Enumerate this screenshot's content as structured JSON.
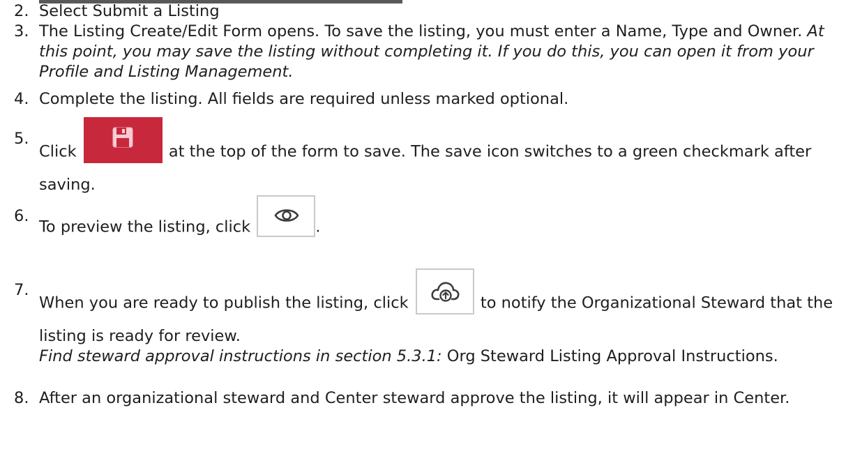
{
  "steps": [
    {
      "num": "2.",
      "text": "Select Submit a Listing"
    },
    {
      "num": "3.",
      "text": "The Listing Create/Edit Form opens. To save the listing, you must enter a Name, Type and Owner. ",
      "italic": "At this point, you may save the listing without completing it. If you do this, you can open it from your Profile and Listing Management."
    },
    {
      "num": "4.",
      "text": "Complete the listing. All fields are required unless marked optional."
    },
    {
      "num": "5.",
      "before": "Click ",
      "after": " at the top of the form to save. The save icon switches to a green checkmark after saving."
    },
    {
      "num": "6.",
      "before": "To preview the listing, click ",
      "after": "."
    },
    {
      "num": "7.",
      "before": "When you are ready to publish the listing, click ",
      "after": " to notify the Organizational Steward that the listing is ready for review.",
      "italic": "Find steward approval instructions in section 5.3.1:",
      "tail": " Org Steward Listing Approval Instructions."
    },
    {
      "num": "8.",
      "text": "After an organizational steward and Center steward approve the listing, it will appear in Center."
    }
  ],
  "icons": {
    "save": "floppy-disk-icon",
    "preview": "eye-icon",
    "publish": "cloud-upload-icon"
  },
  "colors": {
    "save_button": "#c8283c",
    "button_border": "#c9c9c9",
    "icon_stroke": "#3c3c3c",
    "text": "#1e1e1e"
  }
}
